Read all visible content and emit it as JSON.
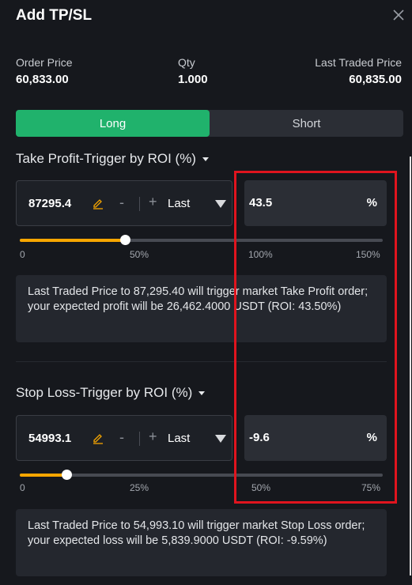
{
  "header": {
    "title": "Add TP/SL"
  },
  "order_info": {
    "order_price_label": "Order Price",
    "order_price_value": "60,833.00",
    "qty_label": "Qty",
    "qty_value": "1.000",
    "last_traded_label": "Last Traded Price",
    "last_traded_value": "60,835.00"
  },
  "tabs": {
    "long": "Long",
    "short": "Short",
    "active": "long"
  },
  "take_profit": {
    "title": "Take Profit-Trigger by ROI (%)",
    "price": "87295.4",
    "minus": "-",
    "plus": "+",
    "trigger_type": "Last",
    "roi_value": "43.5",
    "roi_unit": "%",
    "slider_ticks": [
      "0",
      "50%",
      "100%",
      "150%"
    ],
    "slider_level_percent": 43.5,
    "note": "Last Traded Price to 87,295.40 will trigger market Take Profit order; your expected profit will be 26,462.4000 USDT (ROI: 43.50%)"
  },
  "stop_loss": {
    "title": "Stop Loss-Trigger by ROI (%)",
    "price": "54993.1",
    "minus": "-",
    "plus": "+",
    "trigger_type": "Last",
    "roi_value": "-9.6",
    "roi_unit": "%",
    "slider_ticks": [
      "0",
      "25%",
      "50%",
      "75%"
    ],
    "slider_level_percent": 9.6,
    "note": "Last Traded Price to 54,993.10 will trigger market Stop Loss order; your expected loss will be 5,839.9000 USDT (ROI: -9.59%)"
  },
  "colors": {
    "background": "#16181d",
    "accent_green": "#20b26c",
    "slider_fill": "#f7a600",
    "highlight_red": "#e0141e"
  }
}
